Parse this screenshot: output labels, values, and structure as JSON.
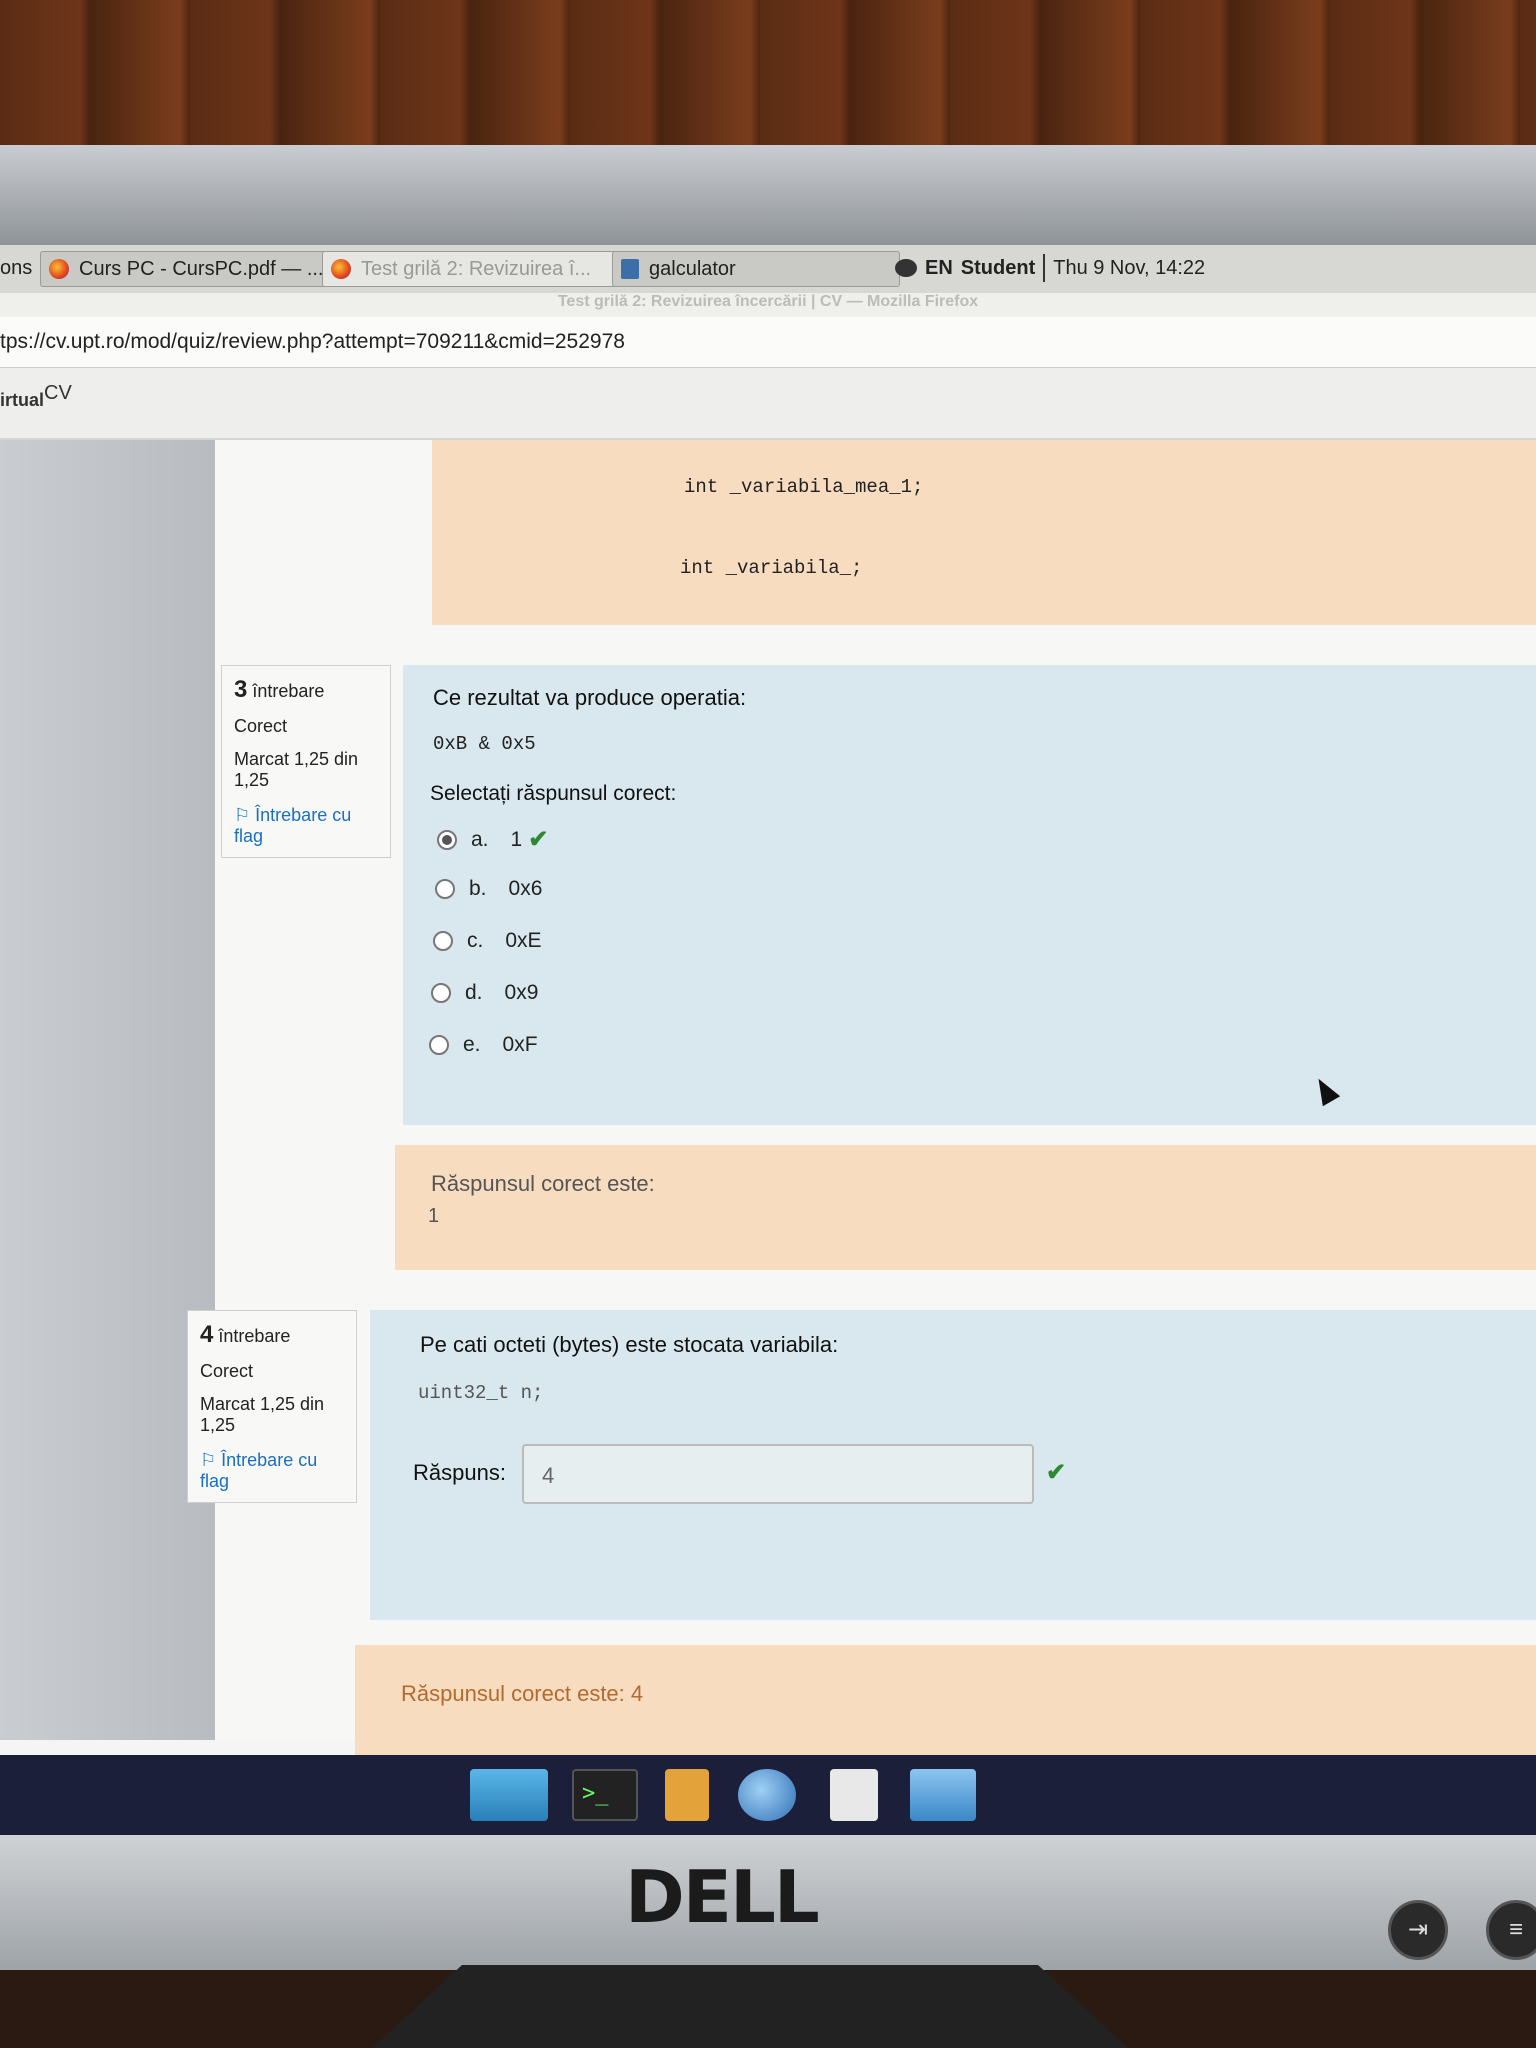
{
  "taskbar": {
    "cut_label": "ons",
    "tabs": [
      {
        "label": "Curs PC - CursPC.pdf — ..."
      },
      {
        "label": "Test grilă 2: Revizuirea î..."
      },
      {
        "label": "galculator"
      }
    ],
    "lang": "EN",
    "user": "Student",
    "clock": "Thu  9 Nov, 14:22"
  },
  "window_title": "Test grilă 2: Revizuirea încercării | CV — Mozilla Firefox",
  "url": "tps://cv.upt.ro/mod/quiz/review.php?attempt=709211&cmid=252978",
  "site": {
    "logo_left": "irtual",
    "logo_sup": "CV"
  },
  "prev_question": {
    "code_lines": [
      "int _variabila_mea_1;",
      "int _variabila_;"
    ]
  },
  "q3": {
    "number": "3",
    "label": "întrebare",
    "status": "Corect",
    "mark": "Marcat 1,25 din 1,25",
    "flag": "Întrebare cu flag",
    "text": "Ce rezultat va produce operatia:",
    "code": "0xB & 0x5",
    "prompt": "Selectați răspunsul corect:",
    "options": [
      {
        "letter": "a.",
        "value": "1",
        "selected": true,
        "correct": true
      },
      {
        "letter": "b.",
        "value": "0x6",
        "selected": false
      },
      {
        "letter": "c.",
        "value": "0xE",
        "selected": false
      },
      {
        "letter": "d.",
        "value": "0x9",
        "selected": false
      },
      {
        "letter": "e.",
        "value": "0xF",
        "selected": false
      }
    ],
    "feedback_label": "Răspunsul corect este:",
    "feedback_value": "1"
  },
  "q4": {
    "number": "4",
    "label": "întrebare",
    "status": "Corect",
    "mark": "Marcat 1,25 din 1,25",
    "flag": "Întrebare cu flag",
    "text": "Pe cati octeti (bytes) este stocata variabila:",
    "code": "uint32_t n;",
    "answer_label": "Răspuns:",
    "answer_value": "4",
    "feedback": "Răspunsul corect este: 4"
  },
  "monitor": {
    "brand": "DELL"
  },
  "colors": {
    "correct": "#2f8a2f",
    "link": "#1a6fc2",
    "feedback_bg": "#f8dcc0",
    "question_bg": "#d9e8ee"
  }
}
